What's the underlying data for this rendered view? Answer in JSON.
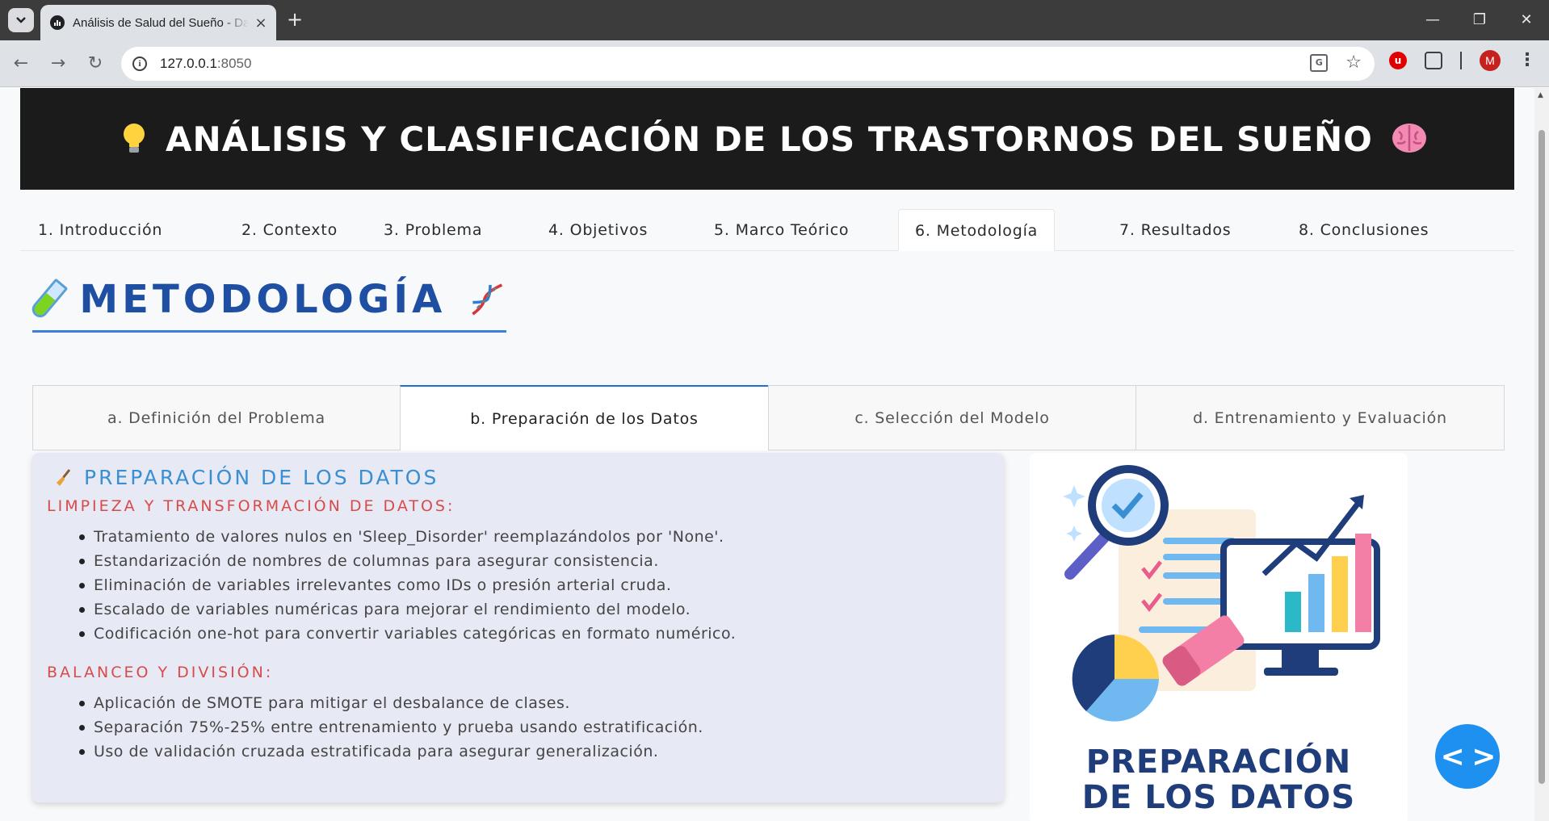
{
  "browser": {
    "tab_title": "Análisis de Salud del Sueño - Dash",
    "tab_close": "×",
    "new_tab": "+",
    "url_host": "127.0.0.1",
    "url_port": ":8050",
    "profile_initial": "M",
    "window_controls": {
      "minimize": "—",
      "restore": "❐",
      "close": "✕"
    }
  },
  "hero": {
    "title": "ANÁLISIS Y CLASIFICACIÓN DE LOS TRASTORNOS DEL SUEÑO",
    "icon_left": "lightbulb-icon",
    "icon_right": "brain-icon"
  },
  "main_tabs": [
    {
      "label": "1. Introducción"
    },
    {
      "label": "2. Contexto"
    },
    {
      "label": "3. Problema"
    },
    {
      "label": "4. Objetivos"
    },
    {
      "label": "5. Marco Teórico"
    },
    {
      "label": "6. Metodología",
      "active": true
    },
    {
      "label": "7. Resultados"
    },
    {
      "label": "8. Conclusiones"
    }
  ],
  "section": {
    "title": "METODOLOGÍA",
    "icon_left": "test-tube-icon",
    "icon_right": "dna-icon"
  },
  "sub_tabs": [
    {
      "label": "a. Definición del Problema"
    },
    {
      "label": "b. Preparación de los Datos",
      "active": true
    },
    {
      "label": "c. Selección del Modelo"
    },
    {
      "label": "d. Entrenamiento y Evaluación"
    }
  ],
  "prep": {
    "title": "PREPARACIÓN DE LOS DATOS",
    "icon": "broom-icon",
    "clean_heading": "LIMPIEZA Y TRANSFORMACIÓN DE DATOS:",
    "clean_items": [
      "Tratamiento de valores nulos en 'Sleep_Disorder' reemplazándolos por 'None'.",
      "Estandarización de nombres de columnas para asegurar consistencia.",
      "Eliminación de variables irrelevantes como IDs o presión arterial cruda.",
      "Escalado de variables numéricas para mejorar el rendimiento del modelo.",
      "Codificación one-hot para convertir variables categóricas en formato numérico."
    ],
    "balance_heading": "BALANCEO Y DIVISIÓN:",
    "balance_items": [
      "Aplicación de SMOTE para mitigar el desbalance de clases.",
      "Separación 75%-25% entre entrenamiento y prueba usando estratificación.",
      "Uso de validación cruzada estratificada para asegurar generalización."
    ]
  },
  "illustration": {
    "line1": "PREPARACIÓN",
    "line2": "DE LOS DATOS"
  },
  "fab": {
    "label": "< >",
    "icon": "code-icon"
  },
  "colors": {
    "hero_bg": "#1b1b1b",
    "section_title": "#1e4fa3",
    "prep_title": "#3a8fd3",
    "subhead": "#d94a4a",
    "card_bg": "#e7eaf4",
    "fab": "#1e90f0"
  }
}
